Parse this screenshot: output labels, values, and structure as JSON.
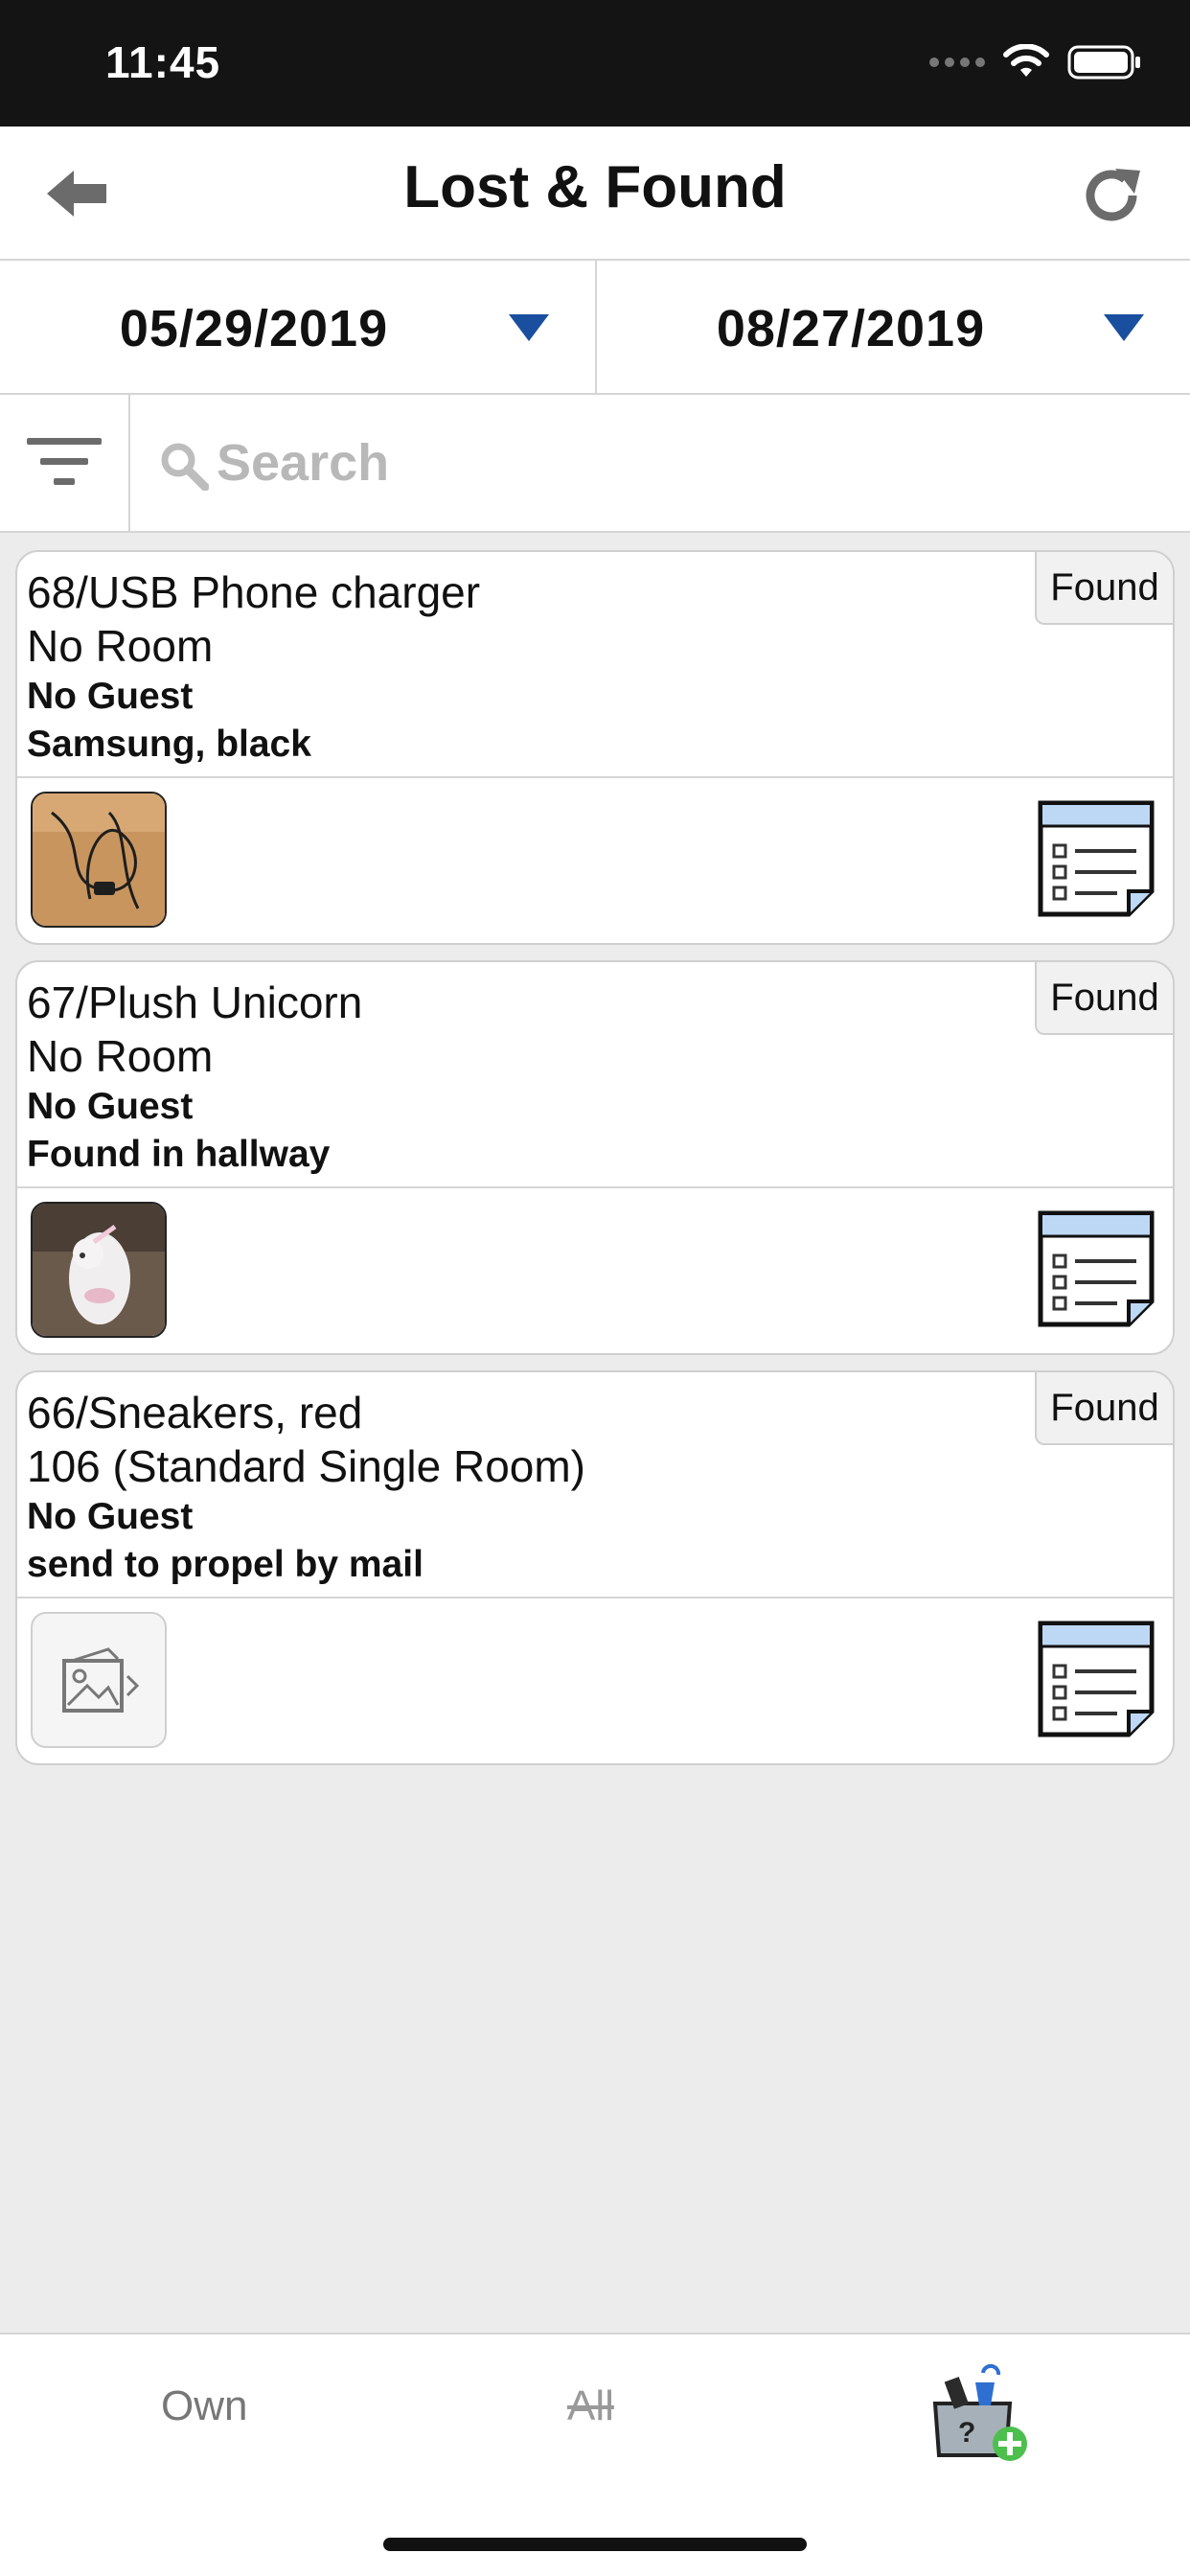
{
  "status_bar": {
    "time": "11:45"
  },
  "header": {
    "title": "Lost & Found"
  },
  "dates": {
    "from": "05/29/2019",
    "to": "08/27/2019"
  },
  "search": {
    "placeholder": "Search",
    "value": ""
  },
  "items": [
    {
      "title": "68/USB Phone charger",
      "room": "No Room",
      "guest": "No Guest",
      "note": "Samsung, black",
      "status": "Found"
    },
    {
      "title": "67/Plush Unicorn",
      "room": "No Room",
      "guest": "No Guest",
      "note": "Found in hallway",
      "status": "Found"
    },
    {
      "title": "66/Sneakers, red",
      "room": "106 (Standard Single Room)",
      "guest": "No Guest",
      "note": "send to propel by mail",
      "status": "Found"
    }
  ],
  "tabs": {
    "own": "Own",
    "all": "All"
  },
  "colors": {
    "accent": "#1a4fa0",
    "status_bar_bg": "#141414",
    "page_bg": "#ececec"
  }
}
